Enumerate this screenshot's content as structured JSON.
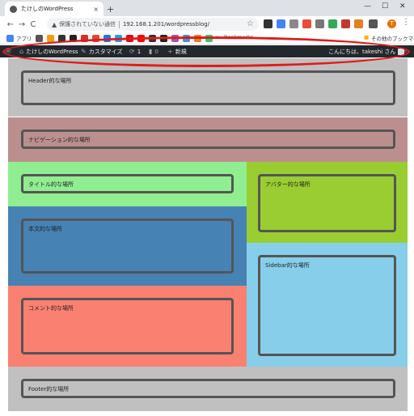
{
  "browser": {
    "tab_title": "たけしのWordPress",
    "tab_close": "×",
    "new_tab": "+",
    "window_minimize": "—",
    "window_maximize": "☐",
    "window_close": "✕",
    "back": "←",
    "forward": "→",
    "reload": "C",
    "security_warning": "保護されていない通信",
    "url": "192.168.1.201/wordpressblog/",
    "profile_initial": "T",
    "menu": "⋮"
  },
  "bookmarks": {
    "apps_label": "アプリ",
    "bookmark_label": "Bookmarks",
    "other_label": "その他のブックマーク"
  },
  "adminbar": {
    "site_name": "たけしのWordPress",
    "customize": "カスタマイズ",
    "updates_count": "1",
    "comments_count": "0",
    "new_label": "新規",
    "greeting": "こんにちは、takeshi さん"
  },
  "page": {
    "header": "Header的な場所",
    "navigation": "ナビゲーション的な場所",
    "title": "タイトル的な場所",
    "avatar": "アバター的な場所",
    "body": "本文的な場所",
    "sidebar": "Sidebar的な場所",
    "comment": "コメント的な場所",
    "footer": "Footer的な場所"
  },
  "colors": {
    "header_bg": "#c0c0c0",
    "nav_bg": "#bc8f8f",
    "title_bg": "#90ee90",
    "avatar_bg": "#9acd32",
    "body_bg": "#4682b4",
    "sidebar_bg": "#87ceeb",
    "comment_bg": "#fa8072",
    "footer_bg": "#c0c0c0",
    "annotation": "#e01b1b"
  }
}
